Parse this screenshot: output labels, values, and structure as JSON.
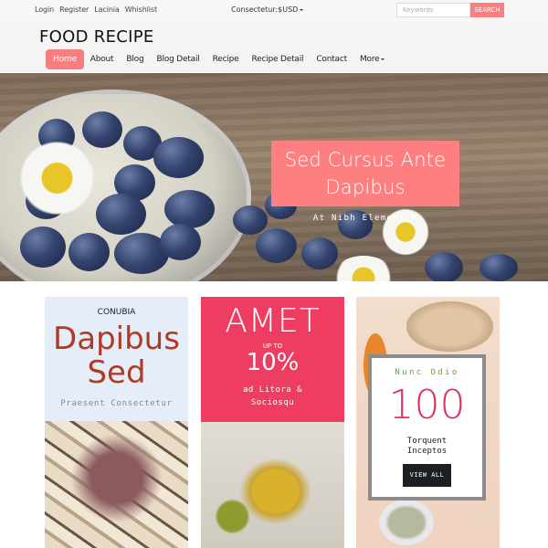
{
  "topbar": {
    "links": [
      "Login",
      "Register",
      "Lacinia",
      "Whishlist"
    ],
    "currency_label": "Consectetur:$USD",
    "search": {
      "placeholder": "Keywords",
      "button_label": "SEARCH"
    }
  },
  "header": {
    "logo": "FOOD RECIPE",
    "nav": [
      {
        "label": "Home",
        "active": true
      },
      {
        "label": "About"
      },
      {
        "label": "Blog"
      },
      {
        "label": "Blog Detail"
      },
      {
        "label": "Recipe"
      },
      {
        "label": "Recipe Detail"
      },
      {
        "label": "Contact"
      },
      {
        "label": "More",
        "dropdown": true
      }
    ]
  },
  "hero": {
    "title": "Sed Cursus Ante Dapibus",
    "subtitle": "At Nibh Elementum"
  },
  "cards": [
    {
      "label": "CONUBIA",
      "title_line1": "Dapibus",
      "title_line2": "Sed",
      "subtitle": "Praesent Consectetur",
      "image": "soap-basket-photo"
    },
    {
      "title": "AMET",
      "prefix": "UP TO",
      "value": "10%",
      "subtitle_line1": "ad Litora &",
      "subtitle_line2": "Sociosqu",
      "image": "olive-oil-photo"
    },
    {
      "kicker": "Nunc Odio",
      "number": "100",
      "desc_line1": "Torquent",
      "desc_line2": "Inceptos",
      "button_label": "VIEW ALL",
      "image": "ginger-turmeric-photo"
    }
  ],
  "colors": {
    "accent": "#f77d7e",
    "card_pink": "#ef3d62",
    "card_blue": "#e4edf8",
    "dapibus_red": "#b03a22",
    "number_red": "#e2325b",
    "kicker_green": "#66a03d",
    "button_dark": "#1c1f24"
  }
}
